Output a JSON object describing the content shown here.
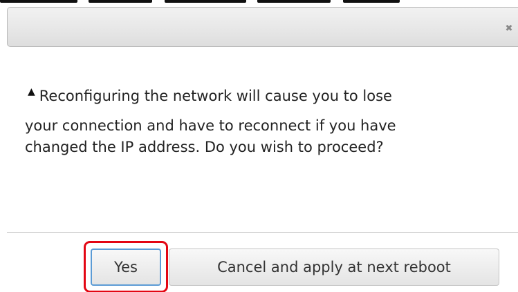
{
  "dialog": {
    "close_glyph": "✖",
    "warning_glyph": "▲",
    "message_line1": "Reconfiguring the network will cause you to lose",
    "message_line2": "your connection and have to reconnect if you have",
    "message_line3": "changed the IP address. Do you wish to proceed?"
  },
  "buttons": {
    "yes_label": "Yes",
    "cancel_label": "Cancel and apply at next reboot"
  },
  "colors": {
    "highlight": "#e30613",
    "focus_border": "#5b9bd5",
    "titlebar": "#dedede"
  },
  "icons": {
    "close": "close-icon",
    "warning": "warning-icon"
  }
}
